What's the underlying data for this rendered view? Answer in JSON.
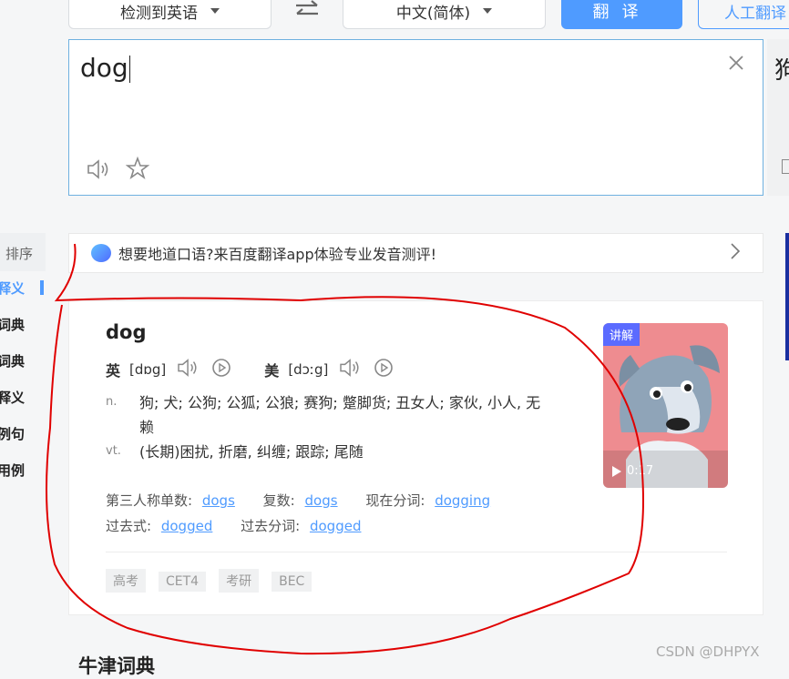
{
  "toolbar": {
    "source_lang": "检测到英语",
    "swap_icon": "swap-arrows-icon",
    "target_lang": "中文(简体)",
    "translate_label": "翻译",
    "human_label": "人工翻译"
  },
  "input": {
    "text": "dog"
  },
  "output": {
    "partial_text": "狗"
  },
  "sidebar": {
    "header": "排序",
    "items": [
      {
        "label": "释义",
        "active": true
      },
      {
        "label": "词典"
      },
      {
        "label": "词典"
      },
      {
        "label": "释义"
      },
      {
        "label": "例句"
      },
      {
        "label": "用例"
      }
    ]
  },
  "banner": {
    "text": "想要地道口语?来百度翻译app体验专业发音测评!"
  },
  "entry": {
    "word": "dog",
    "uk_label": "英",
    "uk_phonetic": "[dɒg]",
    "us_label": "美",
    "us_phonetic": "[dɔːg]",
    "definitions": [
      {
        "pos": "n.",
        "text": "狗; 犬; 公狗; 公狐; 公狼; 赛狗; 蹩脚货; 丑女人; 家伙, 小人, 无赖"
      },
      {
        "pos": "vt.",
        "text": "(长期)困扰, 折磨, 纠缠; 跟踪; 尾随"
      }
    ],
    "forms": [
      {
        "label": "第三人称单数:",
        "value": "dogs"
      },
      {
        "label": "复数:",
        "value": "dogs"
      },
      {
        "label": "现在分词:",
        "value": "dogging"
      },
      {
        "label": "过去式:",
        "value": "dogged"
      },
      {
        "label": "过去分词:",
        "value": "dogged"
      }
    ],
    "tags": [
      "高考",
      "CET4",
      "考研",
      "BEC"
    ],
    "video": {
      "badge": "讲解",
      "duration": "0:17"
    }
  },
  "next_section": {
    "title": "牛津词典"
  },
  "watermark": "CSDN @DHPYX",
  "colors": {
    "accent": "#4f9bff",
    "annotation": "#e00000"
  }
}
